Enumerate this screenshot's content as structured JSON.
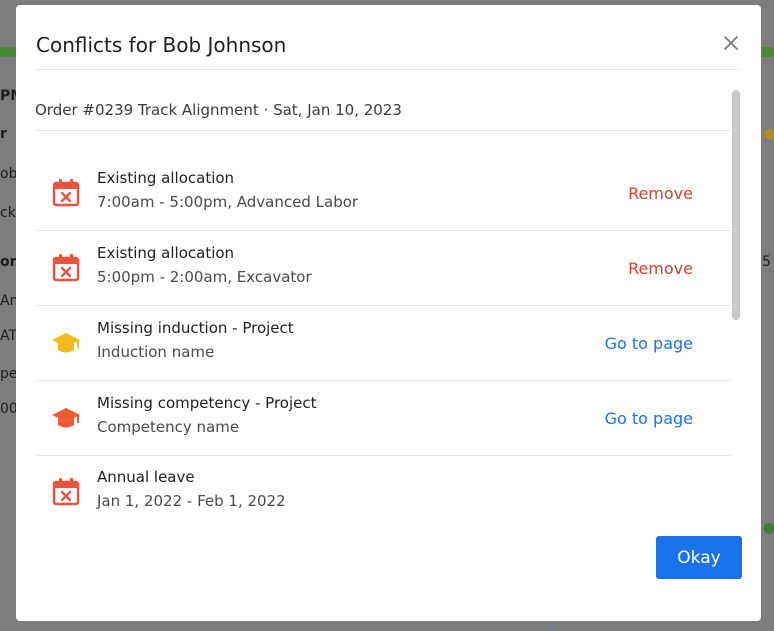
{
  "background": {
    "left_labels": [
      "PM",
      "r",
      "ob",
      "ck",
      "or",
      "Am",
      "ATT",
      "per",
      "00"
    ],
    "right_number": "5"
  },
  "dialog": {
    "title": "Conflicts for Bob Johnson",
    "close_icon": "close-icon",
    "order_line": "Order #0239 Track Alignment · Sat, Jan 10, 2023",
    "conflicts": [
      {
        "icon": "calendar-x-icon",
        "title": "Existing allocation",
        "detail": "7:00am - 5:00pm, Advanced Labor",
        "action": "Remove"
      },
      {
        "icon": "calendar-x-icon",
        "title": "Existing allocation",
        "detail": "5:00pm - 2:00am, Excavator",
        "action": "Remove"
      },
      {
        "icon": "graduation-cap-icon",
        "title": "Missing induction - Project",
        "detail": "Induction name",
        "action": "Go to page"
      },
      {
        "icon": "graduation-cap-icon",
        "title": "Missing competency - Project",
        "detail": "Competency name",
        "action": "Go to page"
      },
      {
        "icon": "calendar-x-icon",
        "title": "Annual leave",
        "detail": "Jan 1, 2022 - Feb 1, 2022",
        "action": ""
      }
    ],
    "okay_label": "Okay"
  },
  "colors": {
    "primary": "#1a73e8",
    "danger": "#d6402c",
    "calendar_icon": "#e8553c",
    "induction_icon": "#f5b819",
    "competency_icon": "#ef5a30"
  }
}
